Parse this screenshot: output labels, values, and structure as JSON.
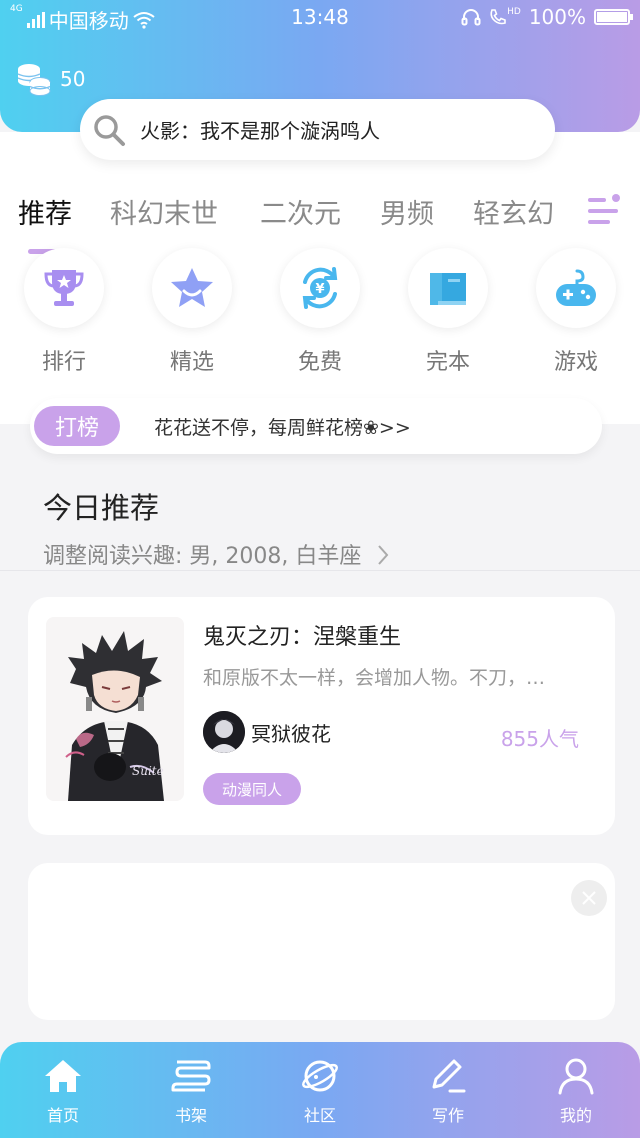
{
  "colors": {
    "accent": "#c9a2ea",
    "header_start": "#4fd0f0",
    "header_end": "#b99ce6"
  },
  "status_bar": {
    "network_type": "4G",
    "carrier": "中国移动",
    "time": "13:48",
    "hd_label": "HD",
    "battery": "100%"
  },
  "coins": {
    "icon": "coins-icon",
    "count": "50"
  },
  "search": {
    "icon": "search-icon",
    "placeholder": "火影：我不是那个漩涡鸣人"
  },
  "tabs": [
    {
      "label": "推荐",
      "active": true
    },
    {
      "label": "科幻末世",
      "active": false
    },
    {
      "label": "二次元",
      "active": false
    },
    {
      "label": "男频",
      "active": false
    },
    {
      "label": "轻玄幻",
      "active": false
    }
  ],
  "tabs_menu_icon": "category-menu-icon",
  "quick_entries": [
    {
      "label": "排行",
      "icon": "trophy-icon"
    },
    {
      "label": "精选",
      "icon": "star-icon"
    },
    {
      "label": "免费",
      "icon": "free-coin-icon"
    },
    {
      "label": "完本",
      "icon": "book-icon"
    },
    {
      "label": "游戏",
      "icon": "gamepad-icon"
    }
  ],
  "notice": {
    "badge": "打榜",
    "text": "花花送不停，每周鲜花榜❀>>"
  },
  "recommend": {
    "title": "今日推荐",
    "subtitle": "调整阅读兴趣: 男, 2008, 白羊座"
  },
  "book": {
    "title": "鬼灭之刃：涅槃重生",
    "desc": "和原版不太一样，会增加人物。不刀，…",
    "author": "冥狱彼花",
    "popularity": "855人气",
    "tag": "动漫同人",
    "cover_icon": "anime-cover-image",
    "cover_signature": "Suite"
  },
  "bottom_nav": [
    {
      "label": "首页",
      "icon": "home-icon"
    },
    {
      "label": "书架",
      "icon": "bookshelf-icon"
    },
    {
      "label": "社区",
      "icon": "planet-icon"
    },
    {
      "label": "写作",
      "icon": "pen-icon"
    },
    {
      "label": "我的",
      "icon": "user-icon"
    }
  ]
}
